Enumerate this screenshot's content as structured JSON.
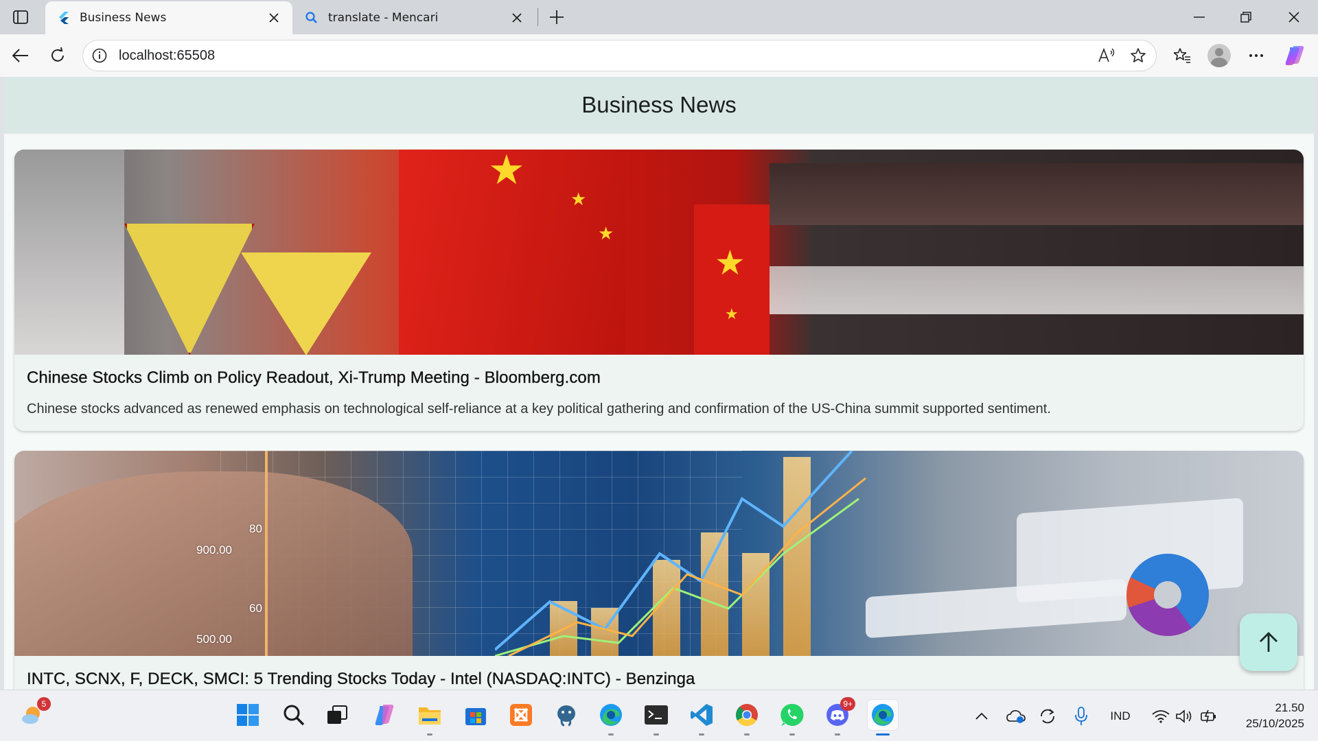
{
  "browser": {
    "tabs": [
      {
        "title": "Business News",
        "active": true,
        "icon": "flutter-icon"
      },
      {
        "title": "translate - Mencari",
        "active": false,
        "icon": "search-icon"
      }
    ],
    "url": "localhost:65508"
  },
  "app": {
    "title": "Business News",
    "articles": [
      {
        "title": "Chinese Stocks Climb on Policy Readout, Xi-Trump Meeting - Bloomberg.com",
        "description": "Chinese stocks advanced as renewed emphasis on technological self-reliance at a key political gathering and confirmation of the US-China summit supported sentiment.",
        "image": "china-flags-image"
      },
      {
        "title": "INTC, SCNX, F, DECK, SMCI: 5 Trending Stocks Today - Intel (NASDAQ:INTC) - Benzinga",
        "description": "",
        "image": "stock-chart-image",
        "image_labels": [
          "900.00",
          "500.00",
          "80",
          "60"
        ]
      }
    ],
    "fab_icon": "arrow-up-icon"
  },
  "taskbar": {
    "weather_badge": "5",
    "discord_badge": "9+",
    "language": "IND",
    "time": "21.50",
    "date": "25/10/2025",
    "apps": [
      "start-icon",
      "search-icon",
      "task-view-icon",
      "copilot-icon",
      "file-explorer-icon",
      "microsoft-store-icon",
      "xampp-icon",
      "postgresql-icon",
      "edge-icon",
      "terminal-icon",
      "vscode-icon",
      "chrome-icon",
      "whatsapp-icon",
      "discord-icon",
      "edge-active-icon"
    ]
  },
  "colors": {
    "appbar": "#d9e8e5",
    "page_bg": "#f5f9f8",
    "card_bg": "#eef4f2",
    "fab": "#bfeee6"
  }
}
